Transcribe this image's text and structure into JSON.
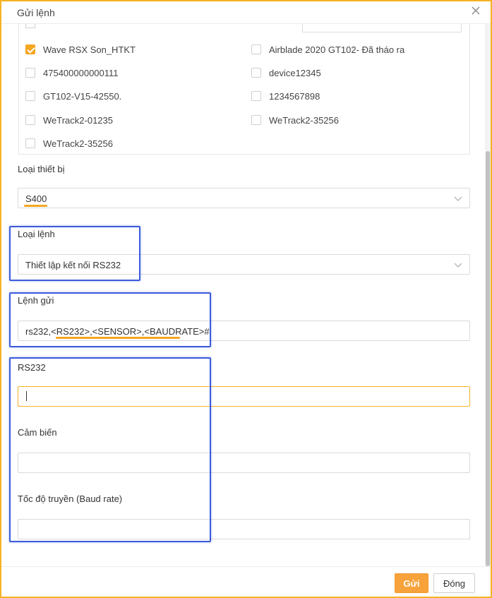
{
  "dialog": {
    "title": "Gửi lệnh"
  },
  "devices": [
    {
      "label": "Wave RSX Son_HTKT",
      "checked": true
    },
    {
      "label": "Airblade 2020 GT102- Đã tháo ra",
      "checked": false
    },
    {
      "label": "475400000000111",
      "checked": false
    },
    {
      "label": "device12345",
      "checked": false
    },
    {
      "label": "GT102-V15-42550.",
      "checked": false
    },
    {
      "label": "1234567898",
      "checked": false
    },
    {
      "label": "WeTrack2-01235",
      "checked": false
    },
    {
      "label": "WeTrack2-35256",
      "checked": false
    },
    {
      "label": "WeTrack2-35256",
      "checked": false
    }
  ],
  "device_type": {
    "label": "Loại thiết bị",
    "value": "S400"
  },
  "command_type": {
    "label": "Loại lệnh",
    "value": "Thiết lập kết nối RS232"
  },
  "command": {
    "label": "Lệnh gửi",
    "prefix": "rs232,",
    "highlight": "<RS232>,<SENSOR>,<BAUDRATE>",
    "suffix": "#"
  },
  "params": {
    "rs232": {
      "label": "RS232",
      "value": ""
    },
    "sensor": {
      "label": "Cảm biến",
      "value": ""
    },
    "baud": {
      "label": "Tốc độ truyền (Baud rate)",
      "value": ""
    }
  },
  "footer": {
    "send_label": "Gửi",
    "close_label": "Đóng"
  },
  "colors": {
    "accent": "#f7a23b",
    "annotation": "#3b5bdb",
    "border": "#f5b324"
  }
}
